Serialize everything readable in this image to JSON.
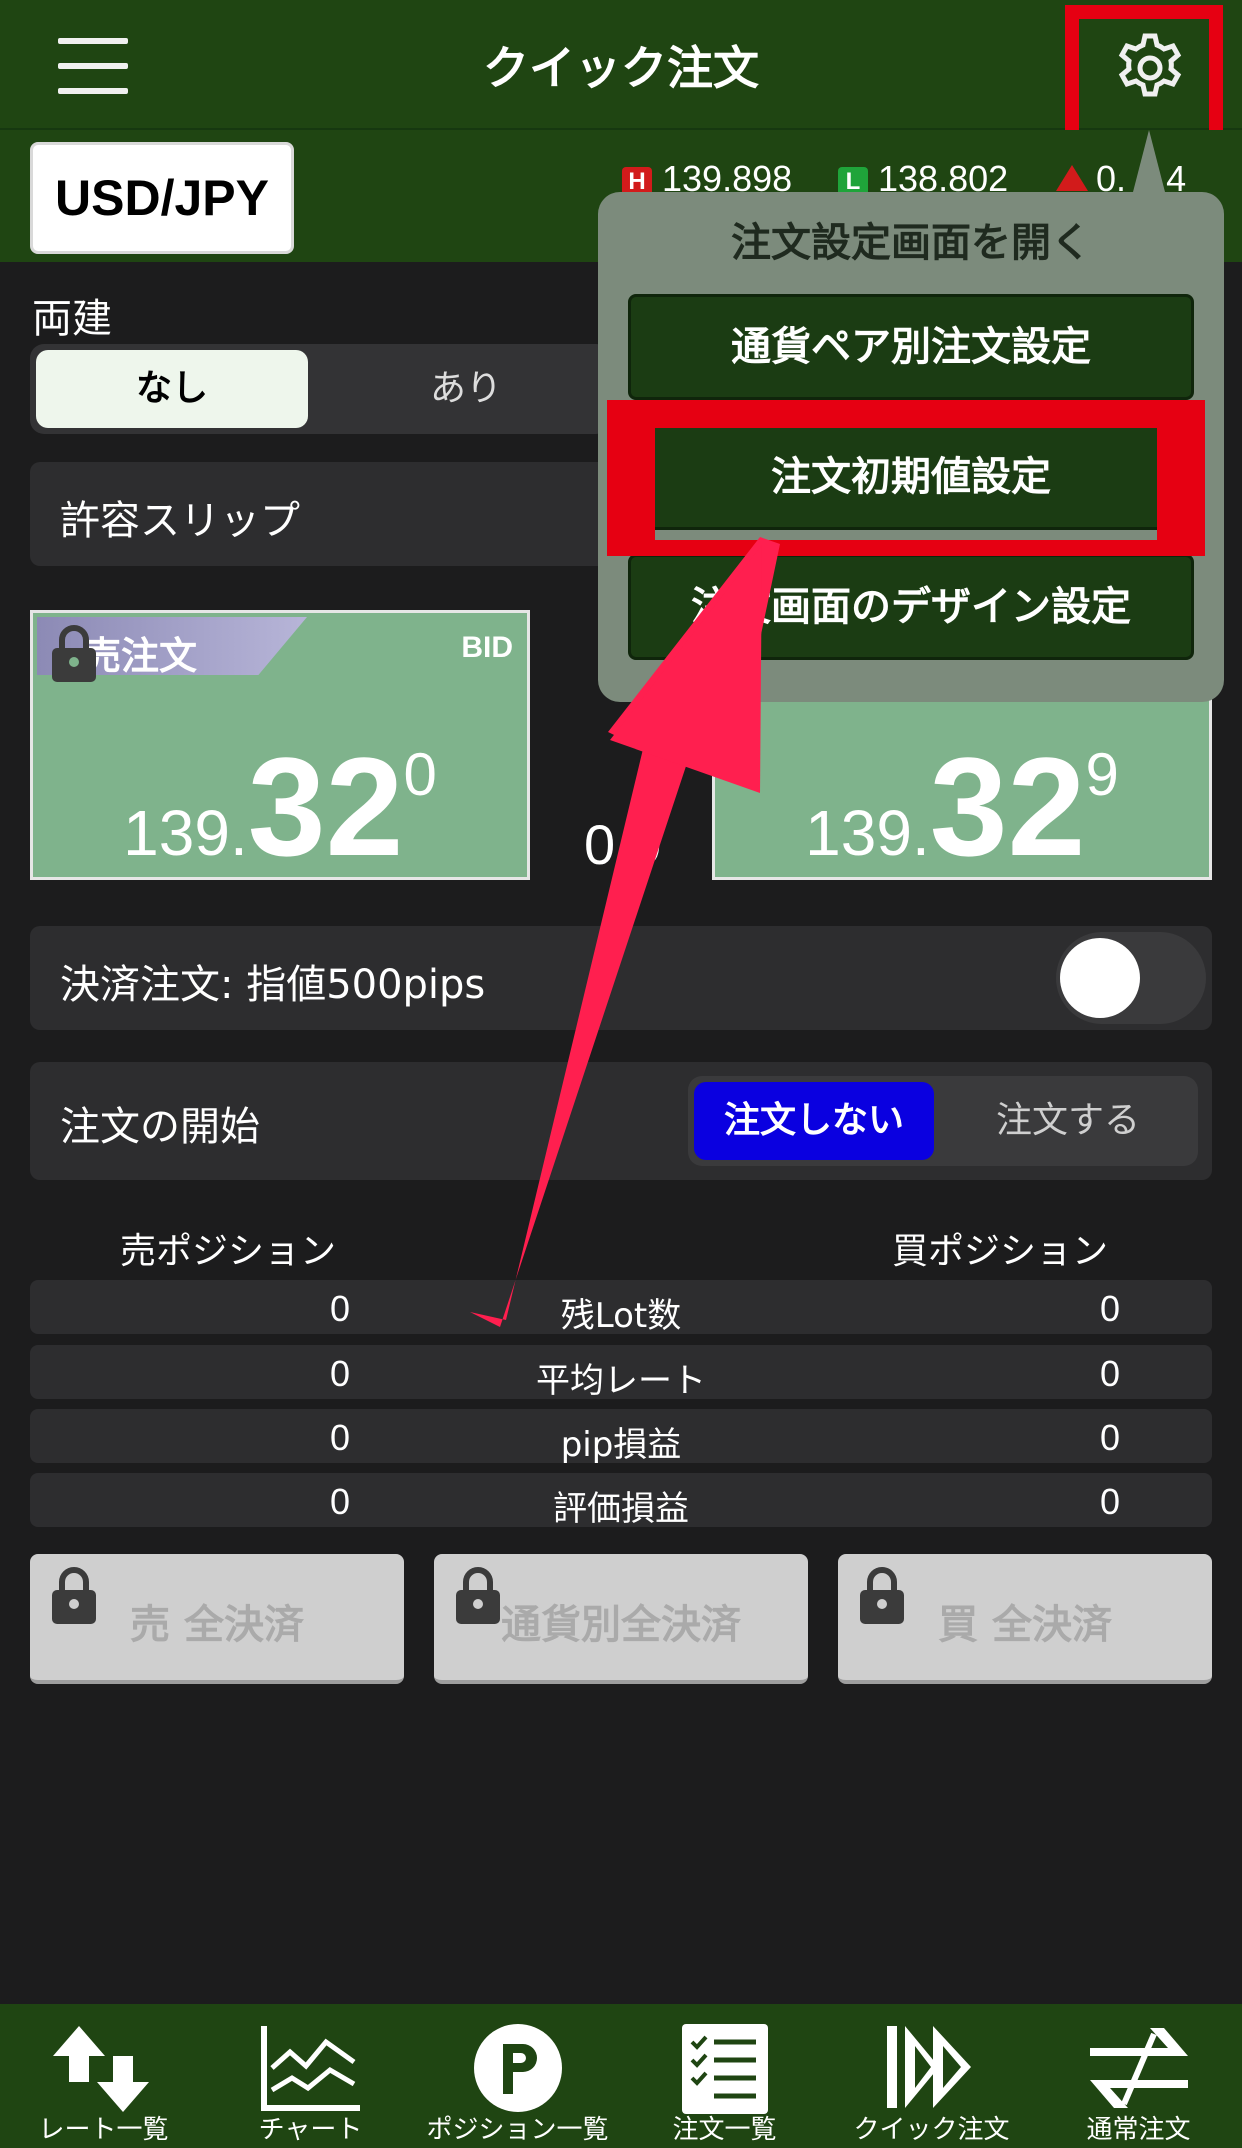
{
  "header": {
    "title": "クイック注文",
    "menu_icon": "hamburger-icon",
    "settings_icon": "gear-icon"
  },
  "pair": {
    "symbol": "USD/JPY",
    "high_badge": "H",
    "high": "139.898",
    "low_badge": "L",
    "low": "138.802",
    "change": "0.__4"
  },
  "hedge": {
    "label": "両建",
    "options": [
      "なし",
      "あり"
    ],
    "selected": "なし"
  },
  "slip": {
    "label": "許容スリップ"
  },
  "sell_panel": {
    "label": "売注文",
    "tag": "BID",
    "price_prefix": "139.",
    "price_big": "32",
    "price_sup": "0"
  },
  "buy_panel": {
    "price_prefix": "139.",
    "price_big": "32",
    "price_sup": "9"
  },
  "spread": "0.9",
  "close_order": {
    "label": "決済注文: 指値500pips",
    "enabled": false
  },
  "order_start": {
    "label": "注文の開始",
    "options": [
      "注文しない",
      "注文する"
    ],
    "selected": "注文しない"
  },
  "positions": {
    "sell_header": "売ポジション",
    "buy_header": "買ポジション",
    "rows": [
      {
        "label": "残Lot数",
        "sell": "0",
        "buy": "0"
      },
      {
        "label": "平均レート",
        "sell": "0",
        "buy": "0"
      },
      {
        "label": "pip損益",
        "sell": "0",
        "buy": "0"
      },
      {
        "label": "評価損益",
        "sell": "0",
        "buy": "0"
      }
    ]
  },
  "settle_buttons": [
    "売 全決済",
    "通貨別全決済",
    "買 全決済"
  ],
  "popover": {
    "title": "注文設定画面を開く",
    "items": [
      "通貨ペア別注文設定",
      "注文初期値設定",
      "注文画面のデザイン設定"
    ]
  },
  "bottom_nav": [
    "レート一覧",
    "チャート",
    "ポジション一覧",
    "注文一覧",
    "クイック注文",
    "通常注文"
  ],
  "colors": {
    "header_green": "#1f4512",
    "panel_green": "#7fb38c",
    "highlight_red": "#e60012",
    "arrow_pink": "#ff1f4f",
    "order_blue": "#0a00e0"
  }
}
